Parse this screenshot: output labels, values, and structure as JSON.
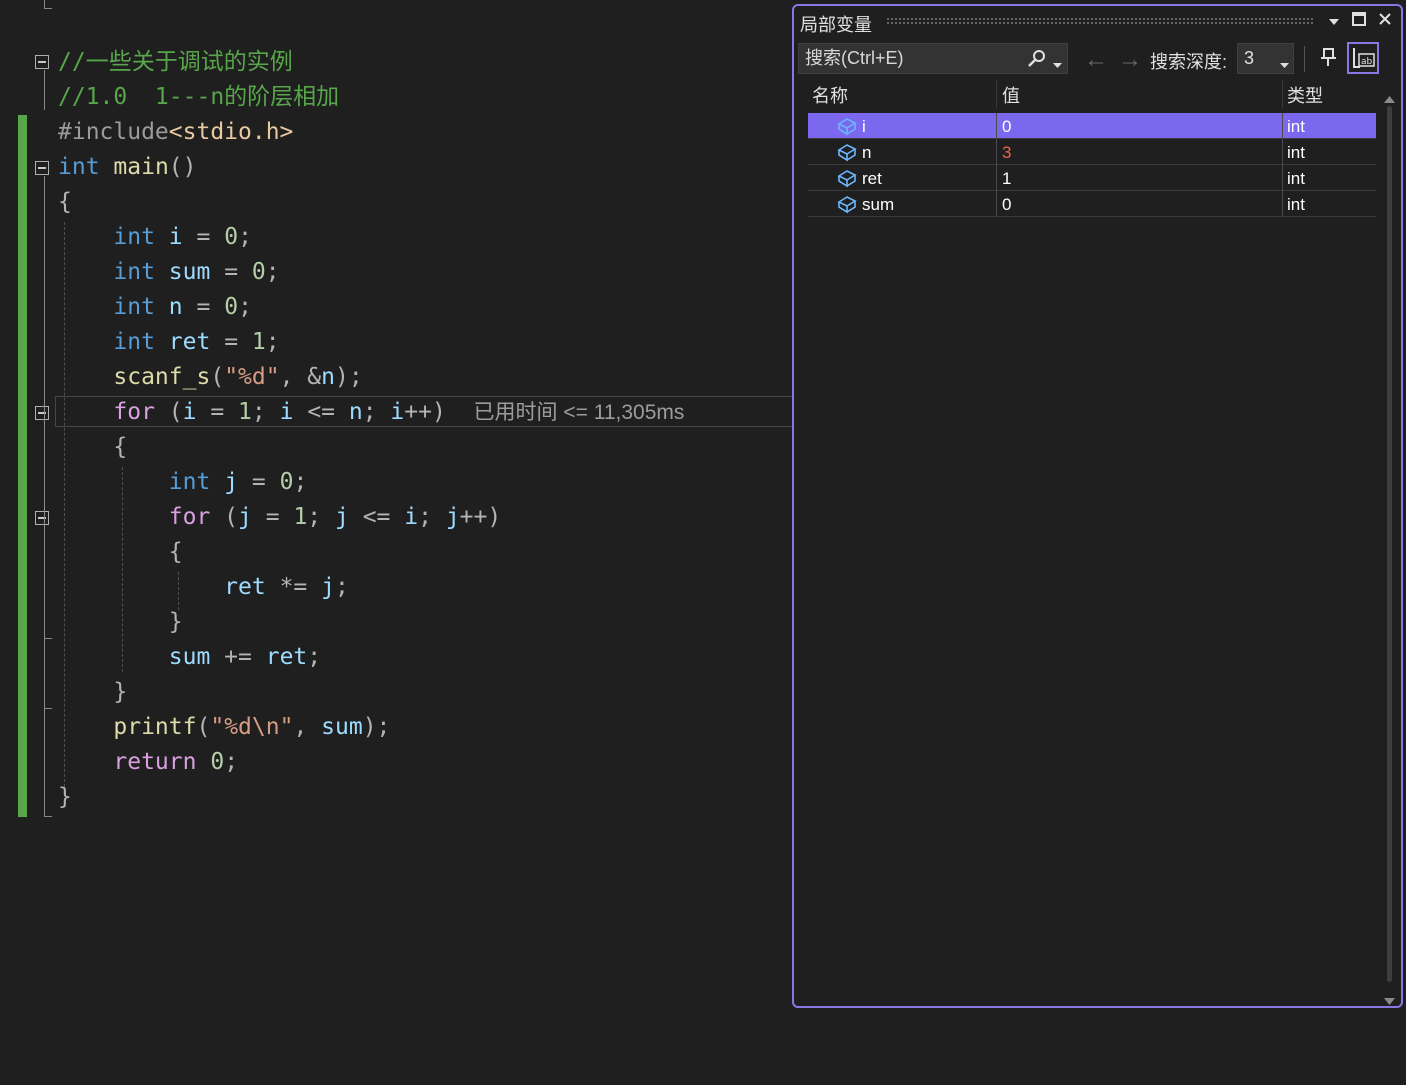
{
  "editor": {
    "lines": [
      {
        "id": "l1",
        "tokens": [
          {
            "c": "t-cmt",
            "t": "//一些关于调试的实例"
          }
        ]
      },
      {
        "id": "l2",
        "tokens": [
          {
            "c": "t-cmt",
            "t": "//1.0  1---n的阶层相加"
          }
        ]
      },
      {
        "id": "l3",
        "tokens": [
          {
            "c": "t-pre",
            "t": "#include"
          },
          {
            "c": "t-inc",
            "t": "<stdio.h>"
          }
        ]
      },
      {
        "id": "l4",
        "tokens": [
          {
            "c": "t-kw",
            "t": "int"
          },
          {
            "c": "t-op",
            "t": " "
          },
          {
            "c": "t-fn",
            "t": "main"
          },
          {
            "c": "t-op",
            "t": "()"
          }
        ]
      },
      {
        "id": "l5",
        "tokens": [
          {
            "c": "t-op",
            "t": "{"
          }
        ]
      },
      {
        "id": "l6",
        "tokens": [
          {
            "c": "t-op",
            "t": "    "
          },
          {
            "c": "t-kw",
            "t": "int"
          },
          {
            "c": "t-op",
            "t": " "
          },
          {
            "c": "t-var",
            "t": "i"
          },
          {
            "c": "t-op",
            "t": " = "
          },
          {
            "c": "t-num",
            "t": "0"
          },
          {
            "c": "t-op",
            "t": ";"
          }
        ]
      },
      {
        "id": "l7",
        "tokens": [
          {
            "c": "t-op",
            "t": "    "
          },
          {
            "c": "t-kw",
            "t": "int"
          },
          {
            "c": "t-op",
            "t": " "
          },
          {
            "c": "t-var",
            "t": "sum"
          },
          {
            "c": "t-op",
            "t": " = "
          },
          {
            "c": "t-num",
            "t": "0"
          },
          {
            "c": "t-op",
            "t": ";"
          }
        ]
      },
      {
        "id": "l8",
        "tokens": [
          {
            "c": "t-op",
            "t": "    "
          },
          {
            "c": "t-kw",
            "t": "int"
          },
          {
            "c": "t-op",
            "t": " "
          },
          {
            "c": "t-var",
            "t": "n"
          },
          {
            "c": "t-op",
            "t": " = "
          },
          {
            "c": "t-num",
            "t": "0"
          },
          {
            "c": "t-op",
            "t": ";"
          }
        ]
      },
      {
        "id": "l9",
        "tokens": [
          {
            "c": "t-op",
            "t": "    "
          },
          {
            "c": "t-kw",
            "t": "int"
          },
          {
            "c": "t-op",
            "t": " "
          },
          {
            "c": "t-var",
            "t": "ret"
          },
          {
            "c": "t-op",
            "t": " = "
          },
          {
            "c": "t-num",
            "t": "1"
          },
          {
            "c": "t-op",
            "t": ";"
          }
        ]
      },
      {
        "id": "l10",
        "tokens": [
          {
            "c": "t-op",
            "t": "    "
          },
          {
            "c": "t-fn",
            "t": "scanf_s"
          },
          {
            "c": "t-op",
            "t": "("
          },
          {
            "c": "t-str",
            "t": "\"%d\""
          },
          {
            "c": "t-op",
            "t": ", &"
          },
          {
            "c": "t-var",
            "t": "n"
          },
          {
            "c": "t-op",
            "t": ");"
          }
        ]
      },
      {
        "id": "l11",
        "tokens": [
          {
            "c": "t-op",
            "t": "    "
          },
          {
            "c": "t-ctl",
            "t": "for"
          },
          {
            "c": "t-op",
            "t": " ("
          },
          {
            "c": "t-var",
            "t": "i"
          },
          {
            "c": "t-op",
            "t": " = "
          },
          {
            "c": "t-num",
            "t": "1"
          },
          {
            "c": "t-op",
            "t": "; "
          },
          {
            "c": "t-var",
            "t": "i"
          },
          {
            "c": "t-op",
            "t": " <= "
          },
          {
            "c": "t-var",
            "t": "n"
          },
          {
            "c": "t-op",
            "t": "; "
          },
          {
            "c": "t-var",
            "t": "i"
          },
          {
            "c": "t-op",
            "t": "++)  "
          },
          {
            "c": "t-hint",
            "t": "已用时间 <= 11,305ms"
          }
        ]
      },
      {
        "id": "l12",
        "tokens": [
          {
            "c": "t-op",
            "t": "    {"
          }
        ]
      },
      {
        "id": "l13",
        "tokens": [
          {
            "c": "t-op",
            "t": "        "
          },
          {
            "c": "t-kw",
            "t": "int"
          },
          {
            "c": "t-op",
            "t": " "
          },
          {
            "c": "t-var",
            "t": "j"
          },
          {
            "c": "t-op",
            "t": " = "
          },
          {
            "c": "t-num",
            "t": "0"
          },
          {
            "c": "t-op",
            "t": ";"
          }
        ]
      },
      {
        "id": "l14",
        "tokens": [
          {
            "c": "t-op",
            "t": "        "
          },
          {
            "c": "t-ctl",
            "t": "for"
          },
          {
            "c": "t-op",
            "t": " ("
          },
          {
            "c": "t-var",
            "t": "j"
          },
          {
            "c": "t-op",
            "t": " = "
          },
          {
            "c": "t-num",
            "t": "1"
          },
          {
            "c": "t-op",
            "t": "; "
          },
          {
            "c": "t-var",
            "t": "j"
          },
          {
            "c": "t-op",
            "t": " <= "
          },
          {
            "c": "t-var",
            "t": "i"
          },
          {
            "c": "t-op",
            "t": "; "
          },
          {
            "c": "t-var",
            "t": "j"
          },
          {
            "c": "t-op",
            "t": "++)"
          }
        ]
      },
      {
        "id": "l15",
        "tokens": [
          {
            "c": "t-op",
            "t": "        {"
          }
        ]
      },
      {
        "id": "l16",
        "tokens": [
          {
            "c": "t-op",
            "t": "            "
          },
          {
            "c": "t-var",
            "t": "ret"
          },
          {
            "c": "t-op",
            "t": " *= "
          },
          {
            "c": "t-var",
            "t": "j"
          },
          {
            "c": "t-op",
            "t": ";"
          }
        ]
      },
      {
        "id": "l17",
        "tokens": [
          {
            "c": "t-op",
            "t": "        }"
          }
        ]
      },
      {
        "id": "l18",
        "tokens": [
          {
            "c": "t-op",
            "t": "        "
          },
          {
            "c": "t-var",
            "t": "sum"
          },
          {
            "c": "t-op",
            "t": " += "
          },
          {
            "c": "t-var",
            "t": "ret"
          },
          {
            "c": "t-op",
            "t": ";"
          }
        ]
      },
      {
        "id": "l19",
        "tokens": [
          {
            "c": "t-op",
            "t": "    }"
          }
        ]
      },
      {
        "id": "l20",
        "tokens": [
          {
            "c": "t-op",
            "t": "    "
          },
          {
            "c": "t-fn",
            "t": "printf"
          },
          {
            "c": "t-op",
            "t": "("
          },
          {
            "c": "t-str",
            "t": "\"%d\\n\""
          },
          {
            "c": "t-op",
            "t": ", "
          },
          {
            "c": "t-var",
            "t": "sum"
          },
          {
            "c": "t-op",
            "t": ");"
          }
        ]
      },
      {
        "id": "l21",
        "tokens": [
          {
            "c": "t-op",
            "t": "    "
          },
          {
            "c": "t-ctl",
            "t": "return"
          },
          {
            "c": "t-op",
            "t": " "
          },
          {
            "c": "t-num",
            "t": "0"
          },
          {
            "c": "t-op",
            "t": ";"
          }
        ]
      },
      {
        "id": "l22",
        "tokens": [
          {
            "c": "t-op",
            "t": "}"
          }
        ]
      }
    ]
  },
  "locals": {
    "title": "局部变量",
    "search_placeholder": "搜索(Ctrl+E)",
    "depth_label": "搜索深度:",
    "depth_value": "3",
    "columns": {
      "name": "名称",
      "value": "值",
      "type": "类型"
    },
    "rows": [
      {
        "name": "i",
        "value": "0",
        "type": "int",
        "selected": true,
        "changed": false
      },
      {
        "name": "n",
        "value": "3",
        "type": "int",
        "selected": false,
        "changed": true
      },
      {
        "name": "ret",
        "value": "1",
        "type": "int",
        "selected": false,
        "changed": false
      },
      {
        "name": "sum",
        "value": "0",
        "type": "int",
        "selected": false,
        "changed": false
      }
    ],
    "colors": {
      "accent": "#8b76e4",
      "selection": "#7b68ee",
      "changed_value": "#f0624f"
    }
  }
}
